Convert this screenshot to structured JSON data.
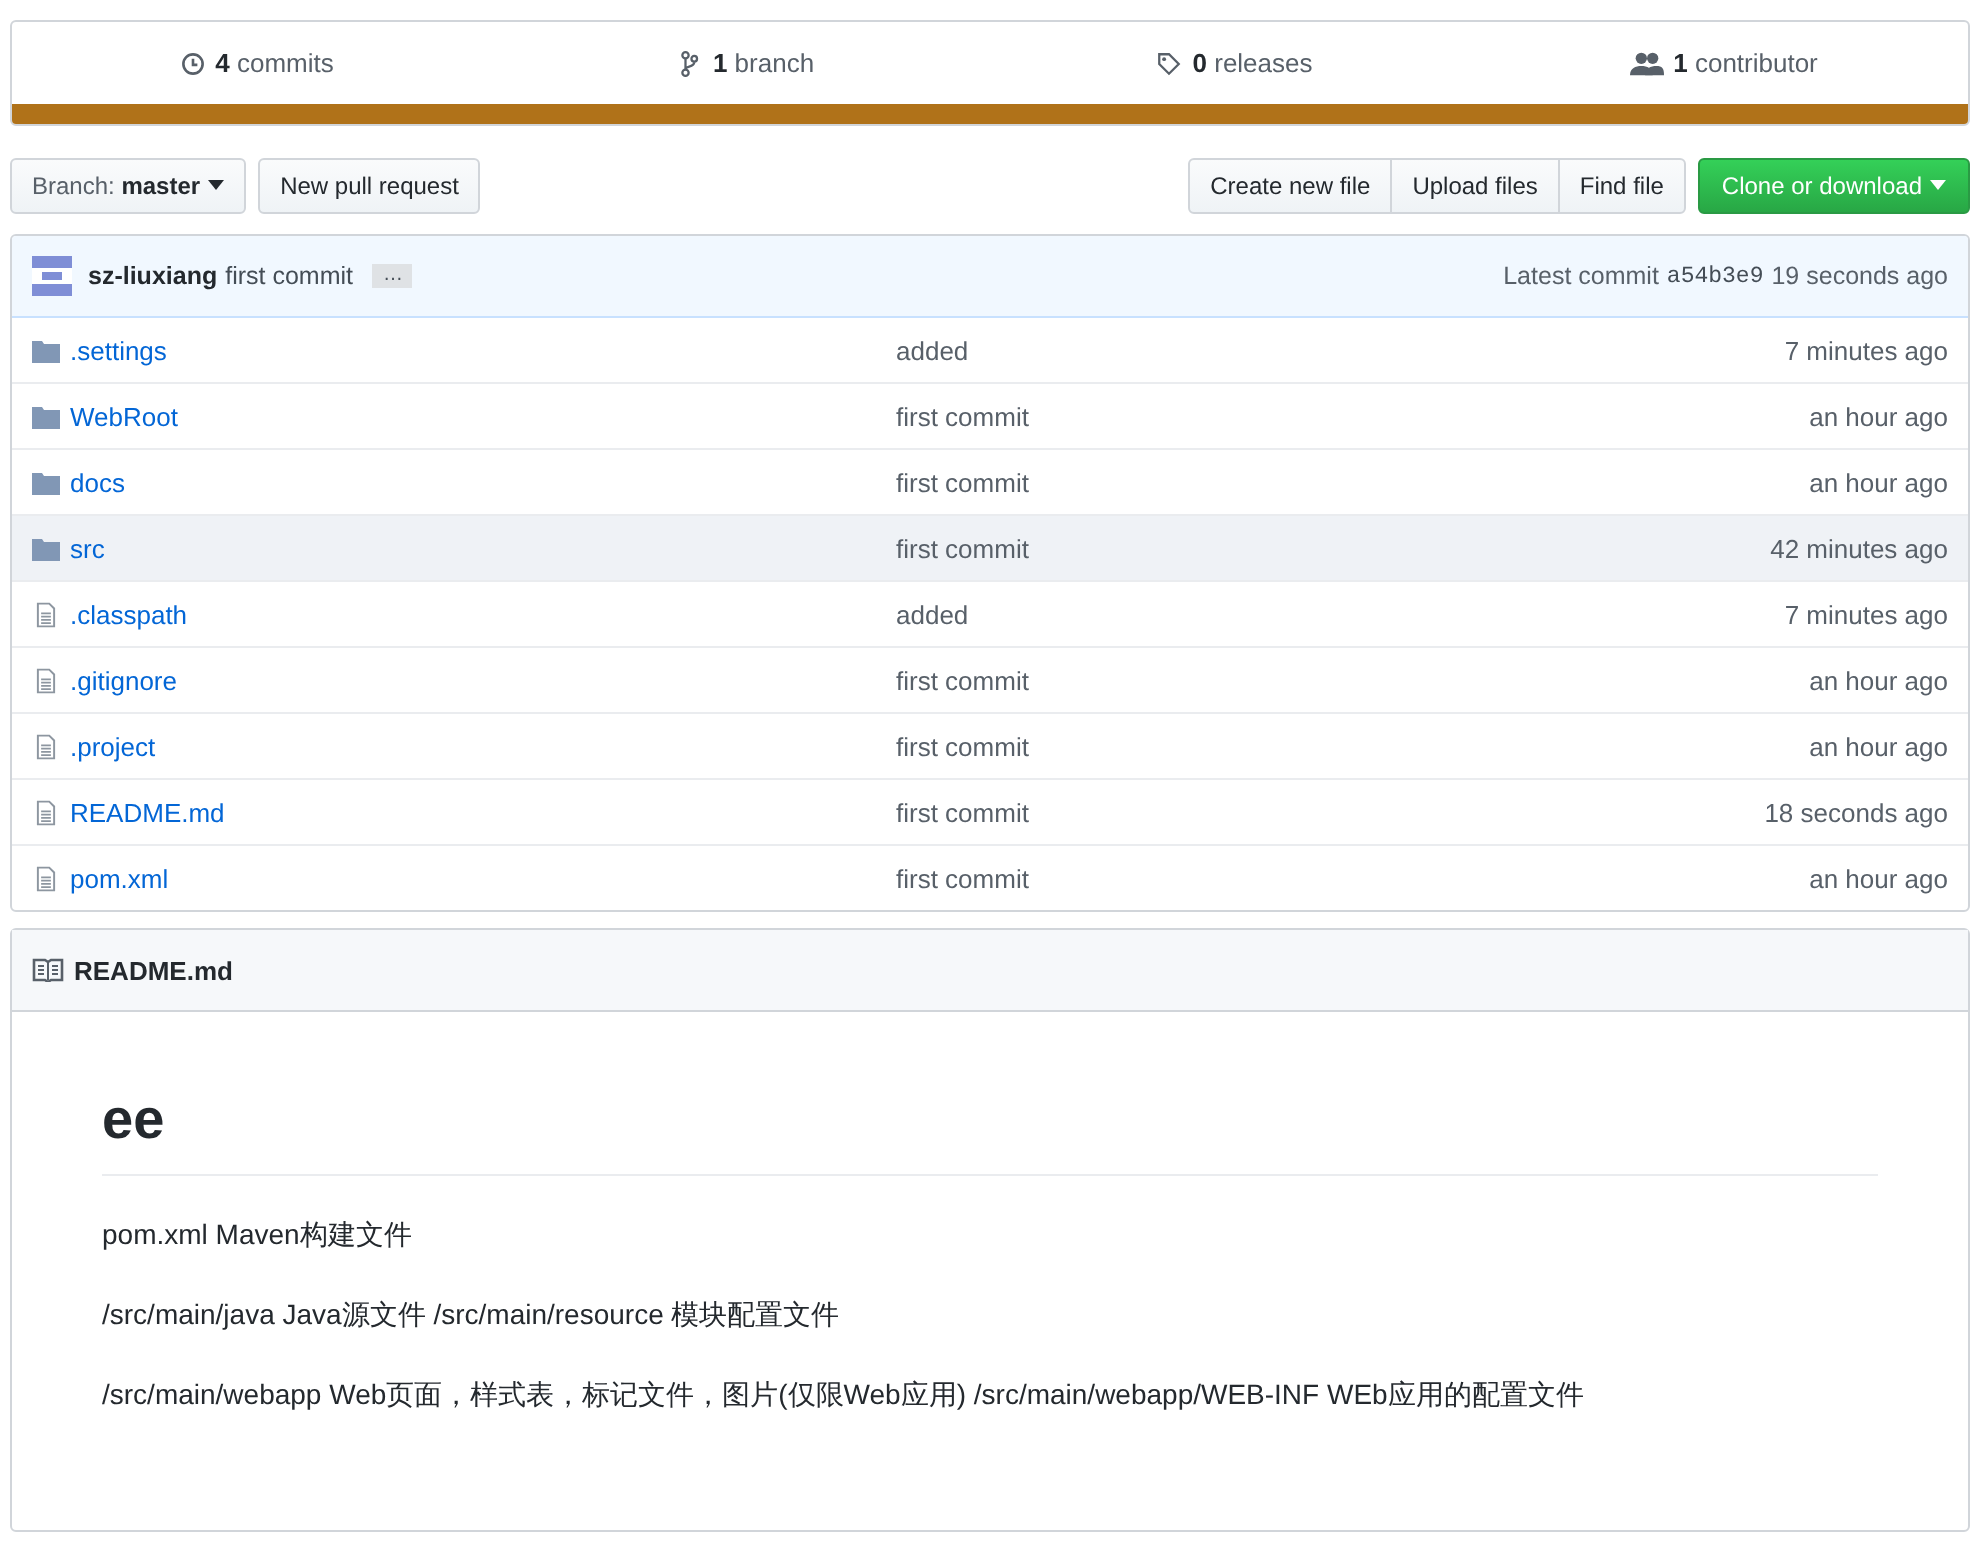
{
  "summary": [
    {
      "kind": "commits",
      "count": "4",
      "label": "commits"
    },
    {
      "kind": "branch",
      "count": "1",
      "label": "branch"
    },
    {
      "kind": "releases",
      "count": "0",
      "label": "releases"
    },
    {
      "kind": "contributors",
      "count": "1",
      "label": "contributor"
    }
  ],
  "branch_button": {
    "label": "Branch:",
    "value": "master"
  },
  "buttons": [
    "New pull request"
  ],
  "file_buttons": [
    "Create new file",
    "Upload files",
    "Find file"
  ],
  "clone_button": "Clone or download",
  "latest_commit": {
    "author": "sz-liuxiang",
    "message": "first commit",
    "ellipsis": "…",
    "label": "Latest commit",
    "sha": "a54b3e9",
    "time": "19 seconds ago"
  },
  "files": [
    {
      "kind": "folder",
      "name": ".settings",
      "message": "added",
      "time": "7 minutes ago",
      "selected": false
    },
    {
      "kind": "folder",
      "name": "WebRoot",
      "message": "first commit",
      "time": "an hour ago",
      "selected": false
    },
    {
      "kind": "folder",
      "name": "docs",
      "message": "first commit",
      "time": "an hour ago",
      "selected": false
    },
    {
      "kind": "folder",
      "name": "src",
      "message": "first commit",
      "time": "42 minutes ago",
      "selected": true
    },
    {
      "kind": "file",
      "name": ".classpath",
      "message": "added",
      "time": "7 minutes ago",
      "selected": false
    },
    {
      "kind": "file",
      "name": ".gitignore",
      "message": "first commit",
      "time": "an hour ago",
      "selected": false
    },
    {
      "kind": "file",
      "name": ".project",
      "message": "first commit",
      "time": "an hour ago",
      "selected": false
    },
    {
      "kind": "file",
      "name": "README.md",
      "message": "first commit",
      "time": "18 seconds ago",
      "selected": false
    },
    {
      "kind": "file",
      "name": "pom.xml",
      "message": "first commit",
      "time": "an hour ago",
      "selected": false
    }
  ],
  "readme": {
    "title": "README.md",
    "heading": "ee",
    "paragraphs": [
      "pom.xml Maven构建文件",
      "/src/main/java Java源文件 /src/main/resource 模块配置文件",
      "/src/main/webapp Web页面，样式表，标记文件，图片(仅限Web应用) /src/main/webapp/WEB-INF WEb应用的配置文件"
    ]
  }
}
